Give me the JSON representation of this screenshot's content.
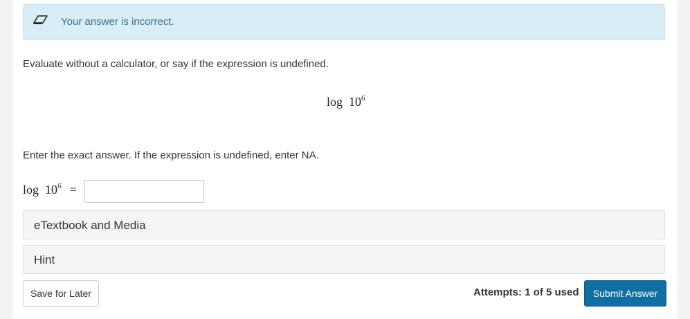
{
  "feedback": {
    "icon": "eraser-icon",
    "message": "Your answer is incorrect.",
    "background_color": "#d9edf7",
    "text_color": "#31708f"
  },
  "question": {
    "prompt": "Evaluate without a calculator, or say if the expression is undefined.",
    "expression": {
      "func": "log",
      "base": "10",
      "exponent": "6"
    },
    "instruction": "Enter the exact answer. If the expression is undefined, enter NA."
  },
  "answer": {
    "label_func": "log",
    "label_base": "10",
    "label_exponent": "6",
    "equals": "=",
    "value": "",
    "placeholder": ""
  },
  "resources": {
    "etextbook_label": "eTextbook and Media",
    "hint_label": "Hint"
  },
  "footer": {
    "save_label": "Save for Later",
    "attempts_text": "Attempts: 1 of 5 used",
    "submit_label": "Submit Answer",
    "submit_color": "#0f6fa2"
  }
}
